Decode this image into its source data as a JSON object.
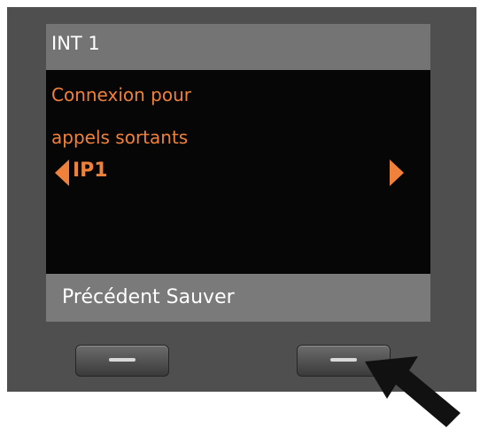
{
  "display": {
    "title": "INT 1",
    "menu_line1": "Connexion pour",
    "menu_line2": "appels sortants",
    "selected_value": "IP1",
    "left_arrow": "left-triangle",
    "right_arrow": "right-triangle"
  },
  "softkeys": {
    "label": "Précédent Sauver"
  },
  "colors": {
    "bezel": "#4f4f4f",
    "titlebar": "#747474",
    "screen": "#060606",
    "accent": "#f0813a",
    "softbar": "#7a7a7a"
  }
}
